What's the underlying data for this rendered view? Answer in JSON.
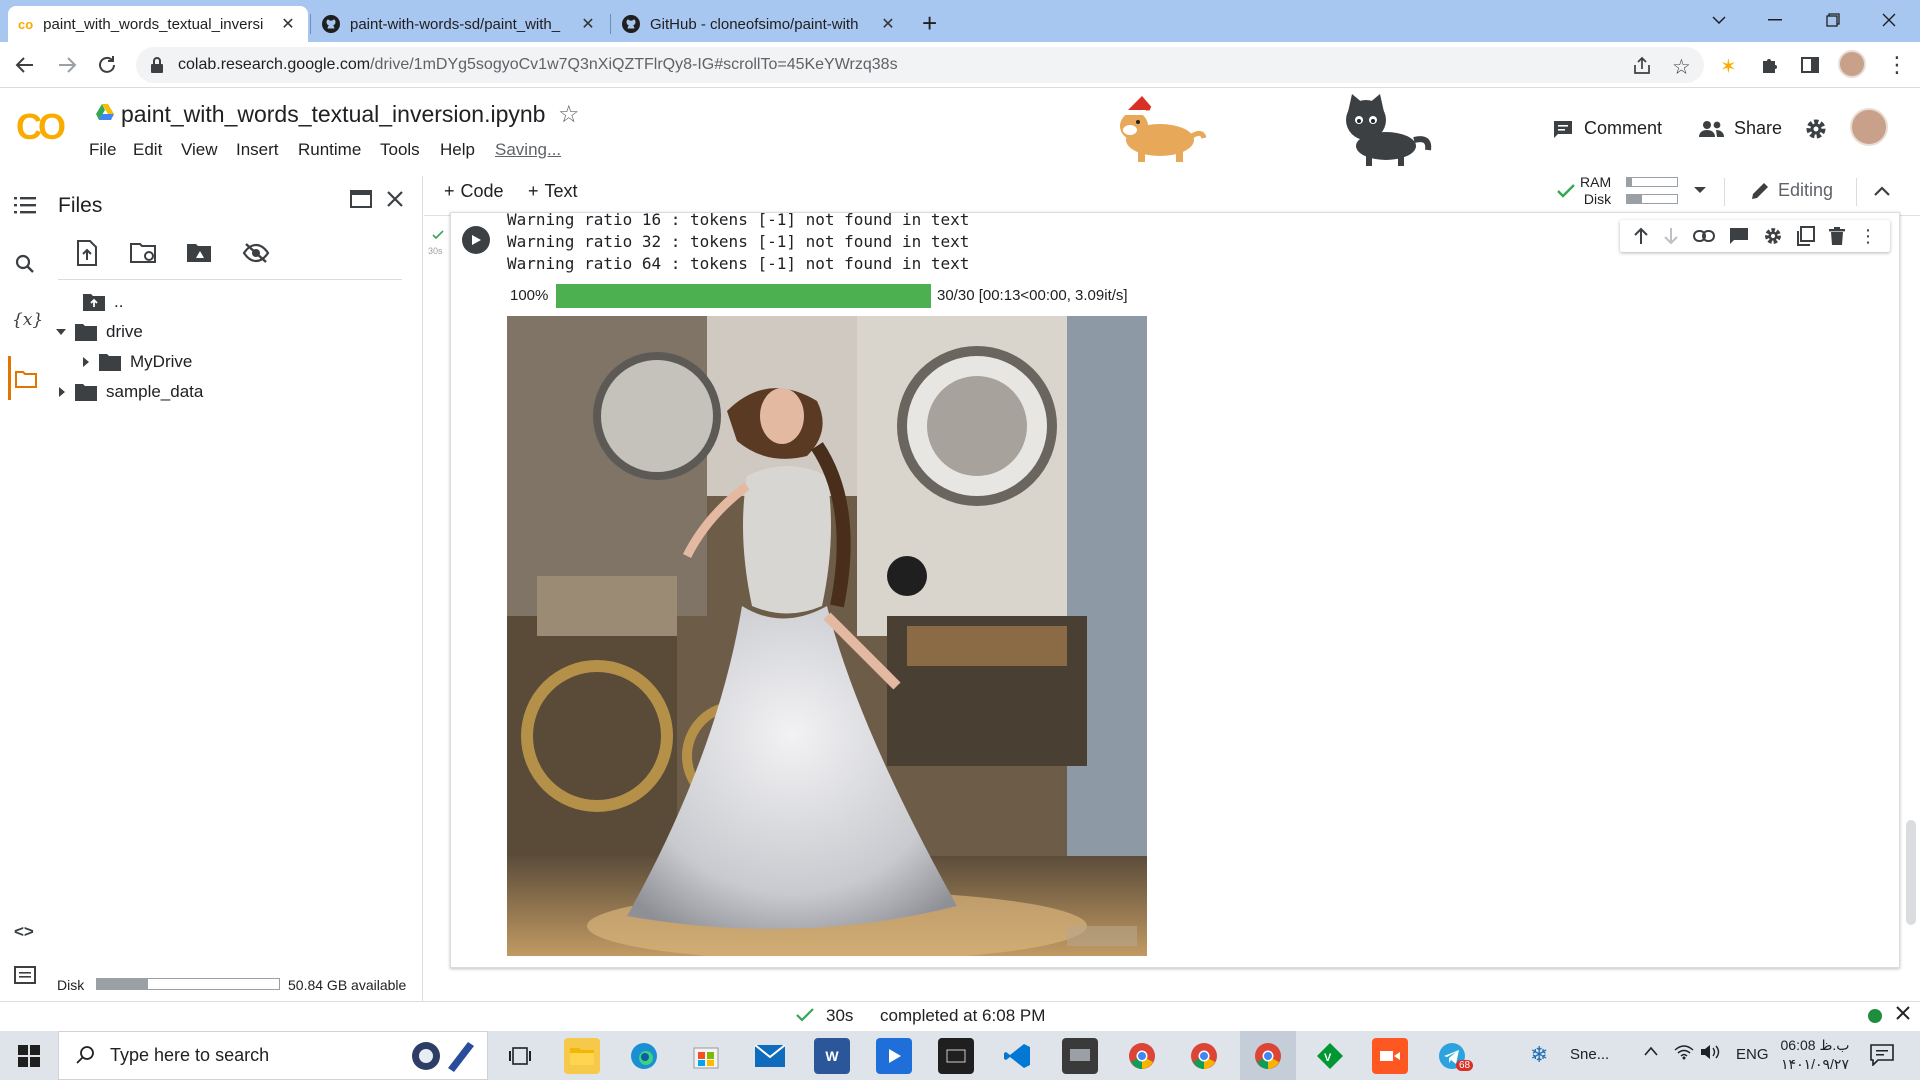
{
  "browser": {
    "tabs": [
      {
        "title": "paint_with_words_textual_inversi",
        "active": true
      },
      {
        "title": "paint-with-words-sd/paint_with_",
        "active": false
      },
      {
        "title": "GitHub - cloneofsimo/paint-with",
        "active": false
      }
    ],
    "url": {
      "host": "colab.research.google.com",
      "path": "/drive/1mDYg5sogyoCv1w7Q3nXiQZTFlrQy8-IG#scrollTo=45KeYWrzq38s"
    }
  },
  "colab": {
    "logo": "CO",
    "notebook_title": "paint_with_words_textual_inversion.ipynb",
    "menu": [
      "File",
      "Edit",
      "View",
      "Insert",
      "Runtime",
      "Tools",
      "Help"
    ],
    "saving": "Saving...",
    "comment_label": "Comment",
    "share_label": "Share"
  },
  "sidebar": {
    "title": "Files",
    "tree": [
      {
        "label": "..",
        "depth": 0,
        "type": "up"
      },
      {
        "label": "drive",
        "depth": 0,
        "type": "folder",
        "expanded": true
      },
      {
        "label": "MyDrive",
        "depth": 1,
        "type": "folder",
        "expanded": false
      },
      {
        "label": "sample_data",
        "depth": 0,
        "type": "folder",
        "expanded": false
      }
    ],
    "disk_label": "Disk",
    "disk_used_fraction": 0.28,
    "disk_available": "50.84 GB available"
  },
  "notebook": {
    "add_code": "Code",
    "add_text": "Text",
    "ram_label": "RAM",
    "disk_label": "Disk",
    "ram_fraction": 0.1,
    "disk_fraction": 0.3,
    "editing_label": "Editing",
    "cell": {
      "exec_time": "30s",
      "output_lines": [
        "Warning ratio 16 : tokens [-1] not found in text",
        "Warning ratio 32 : tokens [-1] not found in text",
        "Warning ratio 64 : tokens [-1] not found in text"
      ],
      "progress_percent": "100%",
      "progress_fraction": 1.0,
      "progress_text": "30/30 [00:13<00:00, 3.09it/s]"
    }
  },
  "status": {
    "time": "30s",
    "text": "completed at 6:08 PM"
  },
  "taskbar": {
    "search_placeholder": "Type here to search",
    "weather_text": "Sne...",
    "lang": "ENG",
    "clock_time": "06:08 ب.ظ",
    "clock_date": "۱۴۰۱/۰۹/۲۷",
    "telegram_badge": "68"
  },
  "colors": {
    "tabstrip": "#a8c7f0",
    "progress": "#4caf50",
    "colab_orange": "#f9ab00",
    "run_button": "#3c4043"
  }
}
